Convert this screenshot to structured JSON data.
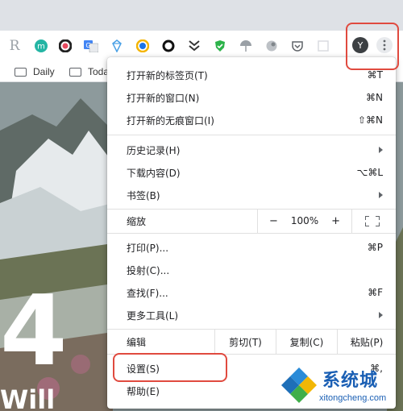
{
  "toolbar": {
    "extensions": [
      {
        "name": "r-extension-icon",
        "glyph": "R",
        "color": "#9aa0a6"
      },
      {
        "name": "m-extension-icon",
        "glyph": "m",
        "color": "#24b5a4"
      },
      {
        "name": "color-wheel-extension-icon",
        "glyph": "",
        "color": "#222222"
      },
      {
        "name": "translate-extension-icon",
        "glyph": "",
        "color": "#4285f4"
      },
      {
        "name": "diamond-extension-icon",
        "glyph": "",
        "color": "#4aa0e6"
      },
      {
        "name": "compass-extension-icon",
        "glyph": "",
        "color": "#f4b400"
      },
      {
        "name": "ring-extension-icon",
        "glyph": "",
        "color": "#111111"
      },
      {
        "name": "double-chevron-extension-icon",
        "glyph": "",
        "color": "#333333"
      },
      {
        "name": "shield-extension-icon",
        "glyph": "",
        "color": "#2db34a"
      },
      {
        "name": "umbrella-extension-icon",
        "glyph": "",
        "color": "#9aa0a6"
      },
      {
        "name": "gray-circle-extension-icon",
        "glyph": "",
        "color": "#9aa0a6"
      },
      {
        "name": "pocket-extension-icon",
        "glyph": "",
        "color": "#5f6368"
      },
      {
        "name": "square-extension-icon",
        "glyph": "",
        "color": "#dadce0"
      }
    ],
    "avatar_letter": "Y"
  },
  "bookmarks": [
    {
      "label": "Daily"
    },
    {
      "label": "Toda"
    }
  ],
  "page": {
    "big_glyph": "4",
    "bottom_text": "Will"
  },
  "menu": {
    "new_tab": {
      "label": "打开新的标签页(T)",
      "shortcut": "⌘T"
    },
    "new_window": {
      "label": "打开新的窗口(N)",
      "shortcut": "⌘N"
    },
    "new_incognito": {
      "label": "打开新的无痕窗口(I)",
      "shortcut": "⇧⌘N"
    },
    "history": {
      "label": "历史记录(H)"
    },
    "downloads": {
      "label": "下载内容(D)",
      "shortcut": "⌥⌘L"
    },
    "bookmarks": {
      "label": "书签(B)"
    },
    "zoom": {
      "label": "缩放",
      "minus": "−",
      "value": "100%",
      "plus": "+"
    },
    "print": {
      "label": "打印(P)...",
      "shortcut": "⌘P"
    },
    "cast": {
      "label": "投射(C)..."
    },
    "find": {
      "label": "查找(F)...",
      "shortcut": "⌘F"
    },
    "more_tools": {
      "label": "更多工具(L)"
    },
    "edit": {
      "label": "编辑",
      "cut": "剪切(T)",
      "copy": "复制(C)",
      "paste": "粘贴(P)"
    },
    "settings": {
      "label": "设置(S)",
      "shortcut": "⌘,"
    },
    "help": {
      "label": "帮助(E)"
    }
  },
  "watermark": {
    "cn": "系统城",
    "en": "xitongcheng.com"
  },
  "colors": {
    "highlight": "#e04a3f",
    "watermark": "#1a5fb4"
  }
}
